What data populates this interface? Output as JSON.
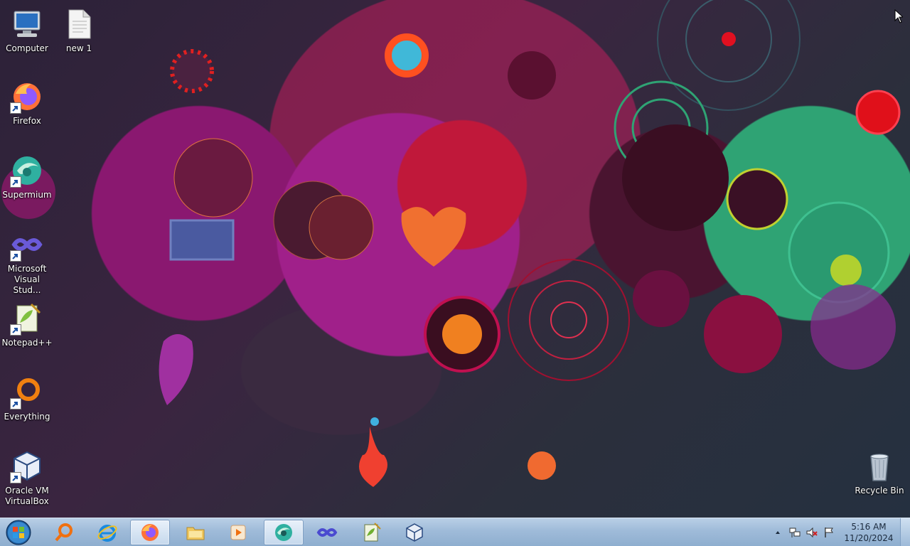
{
  "desktop": {
    "icons": [
      {
        "label": "Computer",
        "icon": "computer-icon",
        "shortcut": false
      },
      {
        "label": "new 1",
        "icon": "text-file-icon",
        "shortcut": false
      },
      {
        "label": "Firefox",
        "icon": "firefox-icon",
        "shortcut": true
      },
      {
        "label": "Supermium",
        "icon": "supermium-icon",
        "shortcut": true
      },
      {
        "label": "Microsoft Visual Stud...",
        "icon": "visual-studio-icon",
        "shortcut": true
      },
      {
        "label": "Notepad++",
        "icon": "notepadpp-icon",
        "shortcut": true
      },
      {
        "label": "Everything",
        "icon": "everything-icon",
        "shortcut": true
      },
      {
        "label": "Oracle VM VirtualBox",
        "icon": "virtualbox-icon",
        "shortcut": true
      },
      {
        "label": "Recycle Bin",
        "icon": "recycle-bin-icon",
        "shortcut": false
      }
    ]
  },
  "taskbar": {
    "start": "start-orb-icon",
    "pinned": [
      {
        "icon": "search-everything-icon",
        "active": false
      },
      {
        "icon": "internet-explorer-icon",
        "active": false
      },
      {
        "icon": "firefox-icon",
        "active": true
      },
      {
        "icon": "file-explorer-icon",
        "active": false
      },
      {
        "icon": "media-player-icon",
        "active": false
      },
      {
        "icon": "supermium-icon",
        "active": true
      },
      {
        "icon": "visual-studio-icon",
        "active": false
      },
      {
        "icon": "notepadpp-icon",
        "active": false
      },
      {
        "icon": "virtualbox-icon",
        "active": false
      }
    ],
    "tray": {
      "icons": [
        "show-hidden-icons-icon",
        "network-icon",
        "volume-muted-icon",
        "action-center-flag-icon"
      ],
      "time": "5:16 AM",
      "date": "11/20/2024"
    }
  },
  "colors": {
    "taskbar": "#9fbbd9",
    "wallpaper_accent": "#c0183a",
    "wallpaper_green": "#2fa374"
  }
}
